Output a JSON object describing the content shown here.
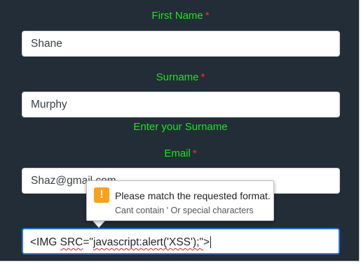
{
  "form": {
    "first_name": {
      "label": "First Name",
      "required_mark": "*",
      "value": "Shane"
    },
    "surname": {
      "label": "Surname",
      "required_mark": "*",
      "value": "Murphy",
      "hint": "Enter your Surname"
    },
    "email": {
      "label": "Email",
      "required_mark": "*",
      "value": "Shaz@gmail.com"
    },
    "active_field": {
      "value_part1": "<IMG ",
      "value_squiggle1": "SRC",
      "value_part2": "=\"",
      "value_squiggle2": "javascript:alert('XSS');\"",
      "value_part3": ">"
    }
  },
  "validation_tooltip": {
    "icon": "warning-icon",
    "title": "Please match the requested format.",
    "detail": "Cant contain ' Or special characters"
  },
  "colors": {
    "background": "#222d38",
    "label": "#19e619",
    "required": "#ff2a2a",
    "focus_border": "#2a73d9",
    "warning": "#f7a21a"
  }
}
